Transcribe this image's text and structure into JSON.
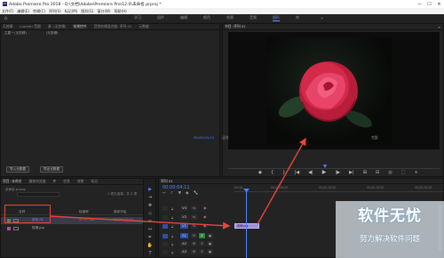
{
  "window": {
    "title": "Adobe Premiere Pro 2018 - D:\\文档\\Adobe\\Premiere Pro\\12.0\\未命名.prproj *",
    "app_icon_text": "Pr",
    "controls": {
      "minimize": "—",
      "maximize": "☐",
      "close": "✕"
    }
  },
  "menu": [
    "文件(F)",
    "编辑(E)",
    "剪辑(C)",
    "序列(S)",
    "标记(M)",
    "图形(G)",
    "窗口(W)",
    "帮助(H)"
  ],
  "workspaces": {
    "tabs": [
      "学习",
      "组件",
      "编辑",
      "颜色",
      "效果",
      "音频",
      "图形",
      "库"
    ],
    "active_index": 6,
    "more": "»"
  },
  "source_panel": {
    "tabs": [
      "无剪辑",
      "Lumetri 范围",
      "源: (无剪辑)",
      "效果控件",
      "音频剪辑混合器: 序列 01",
      "元数据"
    ],
    "active_index": 3,
    "fx_header": [
      "主要 * (无剪辑)",
      "(无剪辑)"
    ],
    "buttons": [
      "导入元数据",
      "导出元数据"
    ]
  },
  "program_panel": {
    "tab": "节目: 序列 01",
    "timecode": "00;00;04;11",
    "fit": "适合",
    "zoom": "完整",
    "transport": [
      "◆",
      "{",
      "}",
      "|◀",
      "◀|",
      "▶",
      "|▶",
      "▶|",
      "⊞",
      "⊟",
      "◎",
      "⬚",
      "+"
    ]
  },
  "project_panel": {
    "tabs": [
      "项目: 未命名",
      "媒体浏览器",
      "库",
      "信息",
      "效果",
      "标记"
    ],
    "active_index": 0,
    "project_name": "未命名.prproj",
    "search_placeholder": "",
    "item_count": "1 项已选择，共 2 项",
    "columns": {
      "name": "名称",
      "frame_rate": "帧速率",
      "media_start": "媒体开始"
    },
    "rows": [
      {
        "name": "序列 01",
        "frame_rate": "29.97 fps",
        "media_start": "00;00;00;00",
        "color": "#4a8f4a"
      },
      {
        "name": "玫瑰.jpg",
        "frame_rate": "",
        "media_start": "",
        "color": "#b04aa8"
      }
    ]
  },
  "tools": [
    "▶",
    "⇥",
    "✥",
    "◇",
    "✂",
    "↔",
    "✒",
    "✋",
    "T"
  ],
  "timeline": {
    "tab": "序列 01",
    "timecode": "00;00;04;11",
    "tool_icons": [
      "↩",
      "⊂",
      "▼",
      "◆",
      "🔧"
    ],
    "ruler_labels": [
      ";00;00",
      "00;00;05;00",
      "00;00;10;00",
      "00;00;15;00",
      "00;00;20;00"
    ],
    "video_tracks": [
      "V3",
      "V2",
      "V1"
    ],
    "audio_tracks": [
      "A1",
      "A2",
      "A3"
    ],
    "clip_label": "玫瑰.jpg"
  },
  "watermark": {
    "logo": "软件无忧",
    "subtitle": "努力解决软件问题"
  }
}
